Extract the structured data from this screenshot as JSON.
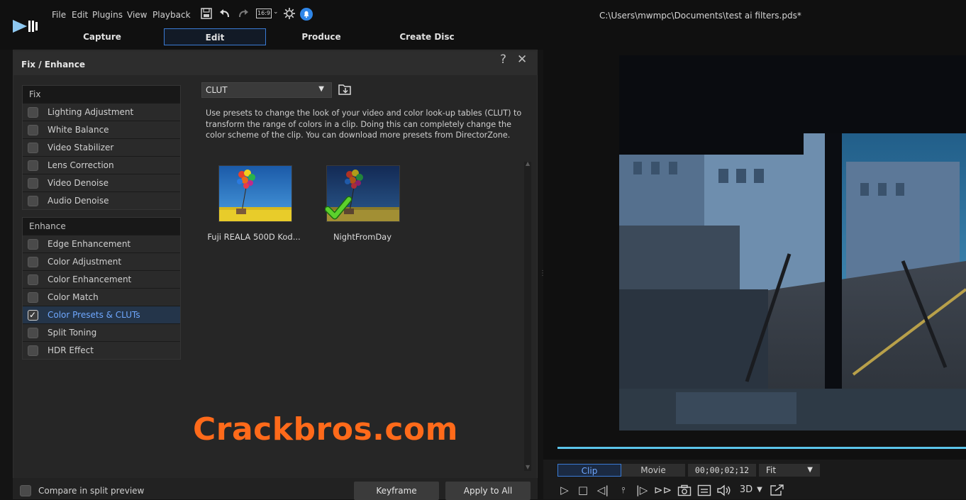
{
  "menu": {
    "items": [
      "File",
      "Edit",
      "Plugins",
      "View",
      "Playback"
    ],
    "notification_count": ""
  },
  "title_bar": {
    "aspect_ratio_label": "16:9",
    "file_path": "C:\\Users\\mwmpc\\Documents\\test ai filters.pds*"
  },
  "tabs": [
    "Capture",
    "Edit",
    "Produce",
    "Create Disc"
  ],
  "panel": {
    "title": "Fix / Enhance",
    "help_glyph": "?",
    "close_glyph": "✕",
    "fix": {
      "header": "Fix",
      "items": [
        "Lighting Adjustment",
        "White Balance",
        "Video Stabilizer",
        "Lens Correction",
        "Video Denoise",
        "Audio Denoise"
      ]
    },
    "enhance": {
      "header": "Enhance",
      "items": [
        "Edge Enhancement",
        "Color Adjustment",
        "Color Enhancement",
        "Color Match",
        "Color Presets & CLUTs",
        "Split Toning",
        "HDR Effect"
      ],
      "selected_index": 4
    },
    "clut_dropdown": {
      "value": "CLUT"
    },
    "description": "Use presets to change the look of your video and color look-up tables (CLUT) to transform the range of colors in a clip. Doing this can completely change the color scheme of the clip. You can download more presets from DirectorZone.",
    "presets": [
      {
        "label": "Fuji REALA 500D Kod...",
        "applied": false
      },
      {
        "label": "NightFromDay",
        "applied": true
      }
    ],
    "watermark": "Crackbros.com",
    "compare_label": "Compare in split preview",
    "keyframe_label": "Keyframe",
    "apply_all_label": "Apply to All"
  },
  "player": {
    "clip_label": "Clip",
    "movie_label": "Movie",
    "timecode": "00;00;02;12",
    "zoom_value": "Fit",
    "mode_3d_label": "3D",
    "playback_progress": 1.0
  },
  "colors": {
    "accent_blue": "#3a7bd5",
    "selected_text": "#6fa8ff",
    "watermark_orange": "#ff6a1a",
    "progress_cyan": "#5bc4ea"
  }
}
